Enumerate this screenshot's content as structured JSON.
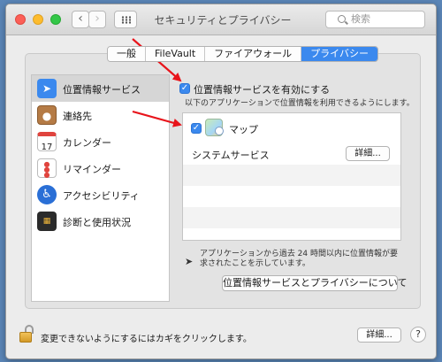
{
  "window": {
    "title": "セキュリティとプライバシー"
  },
  "toolbar": {
    "back_glyph": "‹",
    "forward_glyph": "›"
  },
  "search": {
    "placeholder": "検索"
  },
  "tabs": [
    {
      "label": "一般"
    },
    {
      "label": "FileVault"
    },
    {
      "label": "ファイアウォール"
    },
    {
      "label": "プライバシー",
      "active": true
    }
  ],
  "sidebar": {
    "items": [
      {
        "label": "位置情報サービス",
        "icon": "location-arrow-icon",
        "selected": true
      },
      {
        "label": "連絡先",
        "icon": "contacts-book-icon"
      },
      {
        "label": "カレンダー",
        "icon": "calendar-icon"
      },
      {
        "label": "リマインダー",
        "icon": "reminders-icon"
      },
      {
        "label": "アクセシビリティ",
        "icon": "accessibility-icon"
      },
      {
        "label": "診断と使用状況",
        "icon": "diagnostics-icon"
      }
    ],
    "calendar_day": "17"
  },
  "location": {
    "enable_label": "位置情報サービスを有効にする",
    "enabled": true,
    "description": "以下のアプリケーションで位置情報を利用できるようにします。",
    "apps": [
      {
        "label": "マップ",
        "checked": true,
        "icon": "maps-icon"
      }
    ],
    "system_services_label": "システムサービス",
    "details_button": "詳細...",
    "note": "アプリケーションから過去 24 時間以内に位置情報が要求されたことを示しています。",
    "about_button": "位置情報サービスとプライバシーについて"
  },
  "footer": {
    "lock_label": "変更できないようにするにはカギをクリックします。",
    "advanced_button": "詳細...",
    "help_glyph": "?"
  },
  "colors": {
    "accent": "#3b89ee",
    "annotation_arrow": "#e8141b"
  }
}
